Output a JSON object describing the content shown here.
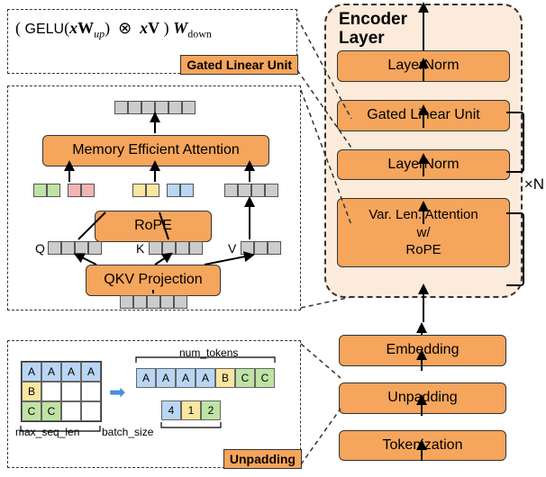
{
  "encoder": {
    "title": "Encoder\nLayer",
    "blocks": {
      "ln1": "LayerNorm",
      "glu": "Gated Linear Unit",
      "ln2": "LayerNorm",
      "attn": "Var. Len. Attention\nw/\nRoPE"
    },
    "repeat": "×N",
    "bottom": {
      "emb": "Embedding",
      "unpad": "Unpadding",
      "tok": "Tokenization"
    }
  },
  "glu": {
    "label": "Gated Linear Unit",
    "formula": {
      "gelu": "GELU",
      "x": "x",
      "Wup": "W",
      "Wup_sub": "up",
      "otimes": "⊗",
      "V": "V",
      "Wdown": "W",
      "Wdown_sub": "down"
    }
  },
  "attn": {
    "mea": "Memory Efficient Attention",
    "rope": "RoPE",
    "qkv": "QKV Projection",
    "q": "Q",
    "k": "K",
    "v": "V"
  },
  "unpad": {
    "label": "Unpadding",
    "num_tokens": "num_tokens",
    "max_seq": "max_seq_len",
    "batch": "batch_size",
    "A": "A",
    "B": "B",
    "C": "C",
    "n4": "4",
    "n1": "1",
    "n2": "2"
  },
  "chart_data": {
    "type": "diagram",
    "note": "Architecture diagram of a transformer-style encoder with unpadding and RoPE-based variable-length attention.",
    "pipeline_bottom_up": [
      "Tokenization",
      "Unpadding",
      "Embedding",
      "Encoder Layer ×N"
    ],
    "encoder_layer_bottom_up": [
      "Var. Len. Attention w/ RoPE",
      "LayerNorm",
      "Gated Linear Unit",
      "LayerNorm"
    ],
    "residuals": [
      "attention → post-LayerNorm",
      "GLU → post-LayerNorm"
    ],
    "glu_formula": "( GELU(x W_up) ⊗ x V ) W_down",
    "attention_detail_bottom_up": [
      "QKV Projection",
      "RoPE (on Q,K)",
      "Memory Efficient Attention"
    ],
    "unpadding_example": {
      "padded": [
        [
          "A",
          "A",
          "A",
          "A"
        ],
        [
          "B",
          "",
          "",
          ""
        ],
        [
          "C",
          "C",
          "",
          ""
        ]
      ],
      "max_seq_len": 4,
      "batch_size": 3,
      "flat_tokens": [
        "A",
        "A",
        "A",
        "A",
        "B",
        "C",
        "C"
      ],
      "lengths": [
        4,
        1,
        2
      ],
      "num_tokens": 7
    }
  }
}
